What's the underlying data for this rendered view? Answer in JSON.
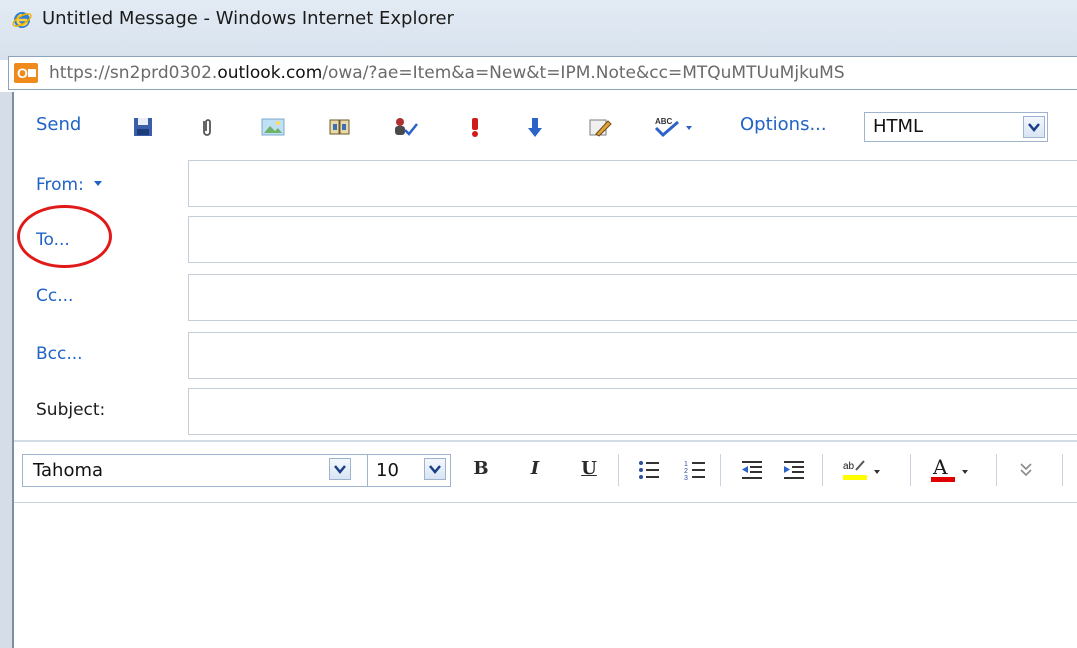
{
  "window": {
    "title": "Untitled Message - Windows Internet Explorer"
  },
  "address": {
    "url_prefix": "https://sn2prd0302.",
    "url_domain": "outlook.com",
    "url_suffix": "/owa/?ae=Item&a=New&t=IPM.Note&cc=MTQuMTUuMjkuMS"
  },
  "toolbar": {
    "send_label": "Send",
    "options_label": "Options...",
    "format_value": "HTML",
    "icons": [
      "save-icon",
      "attach-icon",
      "insert-image-icon",
      "address-book-icon",
      "check-names-icon",
      "high-importance-icon",
      "low-importance-icon",
      "signature-icon",
      "spell-check-icon"
    ]
  },
  "header": {
    "from_label": "From:",
    "to_label": "To...",
    "cc_label": "Cc...",
    "bcc_label": "Bcc...",
    "subject_label": "Subject:",
    "from_value": "",
    "to_value": "",
    "cc_value": "",
    "bcc_value": "",
    "subject_value": ""
  },
  "format": {
    "font_value": "Tahoma",
    "size_value": "10",
    "bold_label": "B",
    "italic_label": "I",
    "underline_label": "U",
    "font_color_label": "A",
    "highlight_color": "#ffff00",
    "font_color": "#e00000"
  },
  "annotation": {
    "circle_color": "#e11919"
  },
  "colors": {
    "link_blue": "#1f63c6"
  }
}
